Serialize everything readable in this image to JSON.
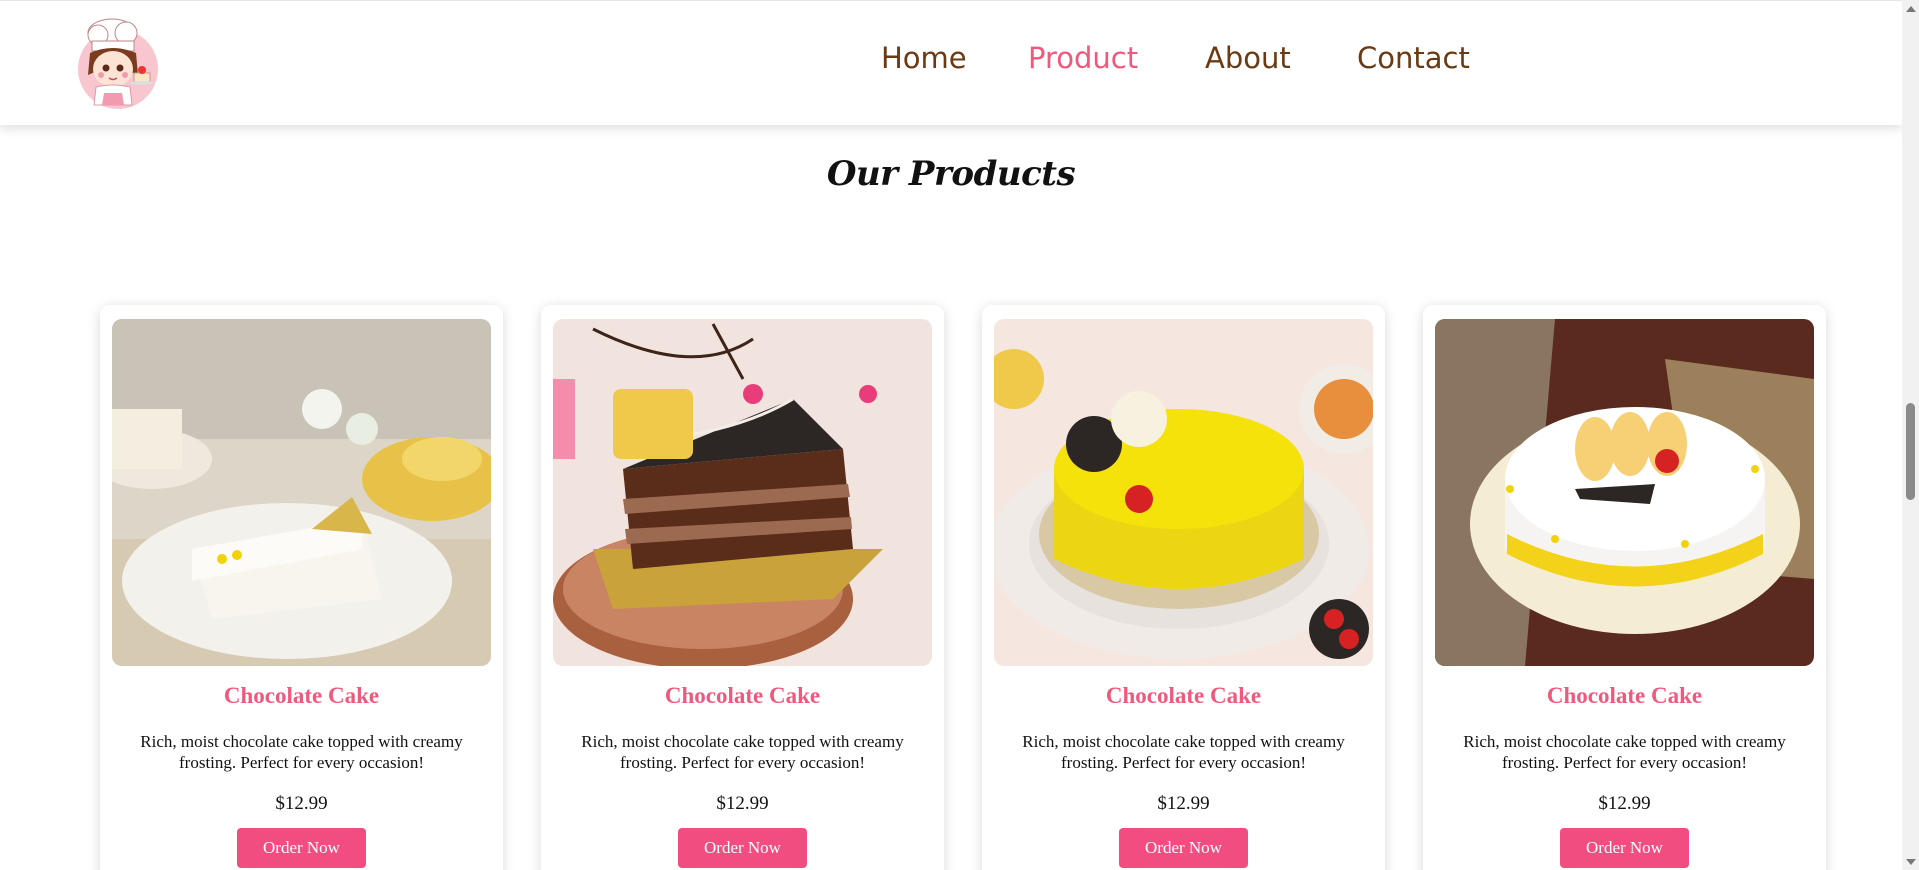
{
  "header": {
    "logo_icon": "chef-girl-logo-icon",
    "nav": [
      {
        "label": "Home",
        "active": false
      },
      {
        "label": "Product",
        "active": true
      },
      {
        "label": "About",
        "active": false
      },
      {
        "label": "Contact",
        "active": false
      }
    ]
  },
  "main": {
    "title": "Our Products",
    "products": [
      {
        "name": "Chocolate Cake",
        "description": "Rich, moist chocolate cake topped with creamy frosting. Perfect for every occasion!",
        "price": "$12.99",
        "button": "Order Now",
        "image": "pineapple-cake-slice-image"
      },
      {
        "name": "Chocolate Cake",
        "description": "Rich, moist chocolate cake topped with creamy frosting. Perfect for every occasion!",
        "price": "$12.99",
        "button": "Order Now",
        "image": "chocolate-cake-slice-image"
      },
      {
        "name": "Chocolate Cake",
        "description": "Rich, moist chocolate cake topped with creamy frosting. Perfect for every occasion!",
        "price": "$12.99",
        "button": "Order Now",
        "image": "yellow-round-cake-image"
      },
      {
        "name": "Chocolate Cake",
        "description": "Rich, moist chocolate cake topped with creamy frosting. Perfect for every occasion!",
        "price": "$12.99",
        "button": "Order Now",
        "image": "pineapple-round-cake-image"
      }
    ]
  },
  "colors": {
    "accent": "#f0587d",
    "nav_text": "#6b3a12",
    "button": "#f24d80"
  }
}
